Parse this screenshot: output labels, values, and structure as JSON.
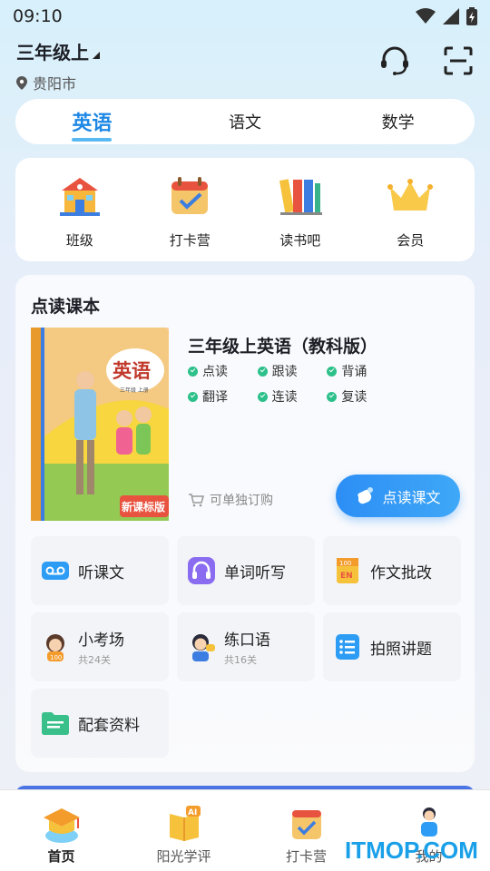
{
  "status_bar": {
    "time": "09:10"
  },
  "header": {
    "grade": "三年级上",
    "city": "贵阳市"
  },
  "subject_tabs": [
    {
      "label": "英语",
      "active": true
    },
    {
      "label": "语文",
      "active": false
    },
    {
      "label": "数学",
      "active": false
    }
  ],
  "quick_links": [
    {
      "label": "班级",
      "icon": "school-icon"
    },
    {
      "label": "打卡营",
      "icon": "calendar-check-icon"
    },
    {
      "label": "读书吧",
      "icon": "books-icon"
    },
    {
      "label": "会员",
      "icon": "crown-icon"
    }
  ],
  "textbook": {
    "section_title": "点读课本",
    "cover_title": "英语",
    "cover_subtitle": "三年级 上册",
    "cover_tag": "新课标版",
    "title": "三年级上英语（教科版）",
    "features": [
      "点读",
      "跟读",
      "背诵",
      "翻译",
      "连读",
      "复读"
    ],
    "buy_label": "可单独订购",
    "read_button": "点读课文"
  },
  "tools": [
    {
      "title": "听课文",
      "sub": "",
      "icon": "tape-icon"
    },
    {
      "title": "单词听写",
      "sub": "",
      "icon": "headphones-icon"
    },
    {
      "title": "作文批改",
      "sub": "",
      "icon": "essay-en-icon"
    },
    {
      "title": "小考场",
      "sub": "共24关",
      "icon": "girl-avatar-icon"
    },
    {
      "title": "练口语",
      "sub": "共16关",
      "icon": "boy-speaking-icon"
    },
    {
      "title": "拍照讲题",
      "sub": "",
      "icon": "list-icon"
    },
    {
      "title": "配套资料",
      "sub": "",
      "icon": "folder-icon"
    }
  ],
  "bottom_tabs": [
    {
      "label": "首页",
      "active": true,
      "icon": "grad-cap-icon"
    },
    {
      "label": "阳光学评",
      "active": false,
      "icon": "ai-book-icon"
    },
    {
      "label": "打卡营",
      "active": false,
      "icon": "calendar-check-icon"
    },
    {
      "label": "我的",
      "active": false,
      "icon": "user-icon"
    }
  ],
  "watermark": "ITMOP.COM",
  "colors": {
    "accent": "#1e88e5",
    "check": "#2cc08a",
    "button": "#2c8ef5"
  }
}
